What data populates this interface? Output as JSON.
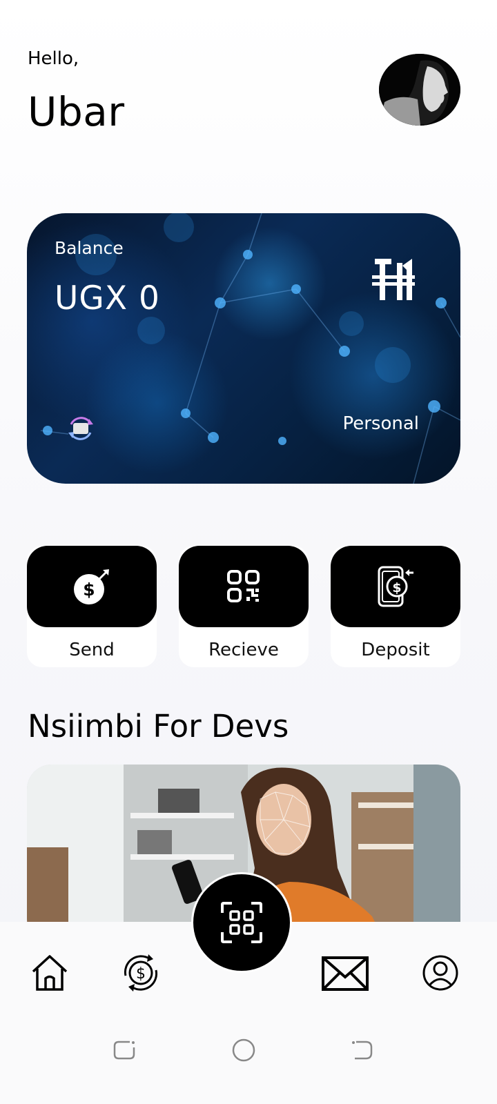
{
  "header": {
    "greeting": "Hello,",
    "username": "Ubar"
  },
  "balance_card": {
    "label": "Balance",
    "amount": "UGX 0",
    "account_type": "Personal",
    "brand_icon": "nsiimbi-logo",
    "sync_icon": "switch-account-icon"
  },
  "actions": [
    {
      "label": "Send",
      "icon": "send-money-icon"
    },
    {
      "label": "Recieve",
      "icon": "qr-code-icon"
    },
    {
      "label": "Deposit",
      "icon": "deposit-phone-icon"
    }
  ],
  "section": {
    "title": "Nsiimbi For Devs"
  },
  "bottom_nav": {
    "items": [
      "home-icon",
      "exchange-icon",
      "scan-icon",
      "mail-icon",
      "profile-icon"
    ]
  },
  "system_nav": [
    "recent-apps-icon",
    "home-circle-icon",
    "back-icon"
  ],
  "colors": {
    "accent": "#000000",
    "card_blue": "#0a2a55",
    "background": "#f7f7fa"
  }
}
